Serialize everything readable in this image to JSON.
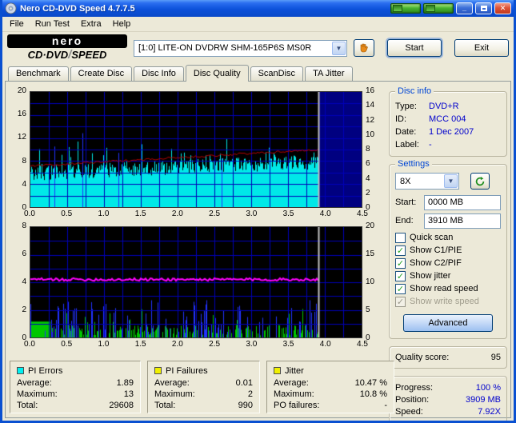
{
  "titlebar": {
    "title": "Nero CD-DVD Speed 4.7.7.5",
    "minimize": "_",
    "close": "✕"
  },
  "menu": [
    "File",
    "Run Test",
    "Extra",
    "Help"
  ],
  "logo": {
    "brand": "nero",
    "product_left": "CD·DVD",
    "sep": "/",
    "product_right": "SPEED"
  },
  "toolbar": {
    "drive": "[1:0]  LITE-ON DVDRW SHM-165P6S MS0R",
    "dropdown_arrow": "▼",
    "start": "Start",
    "exit": "Exit"
  },
  "tabs": [
    "Benchmark",
    "Create Disc",
    "Disc Info",
    "Disc Quality",
    "ScanDisc",
    "TA Jitter"
  ],
  "active_tab": "Disc Quality",
  "disc_info": {
    "title": "Disc info",
    "rows": [
      {
        "label": "Type:",
        "value": "DVD+R"
      },
      {
        "label": "ID:",
        "value": "MCC 004"
      },
      {
        "label": "Date:",
        "value": "1 Dec 2007"
      },
      {
        "label": "Label:",
        "value": "-"
      }
    ]
  },
  "settings": {
    "title": "Settings",
    "speed": "8X",
    "start_label": "Start:",
    "start_value": "0000 MB",
    "end_label": "End:",
    "end_value": "3910 MB",
    "checkboxes": [
      {
        "label": "Quick scan",
        "checked": false
      },
      {
        "label": "Show C1/PIE",
        "checked": true
      },
      {
        "label": "Show C2/PIF",
        "checked": true
      },
      {
        "label": "Show jitter",
        "checked": true
      },
      {
        "label": "Show read speed",
        "checked": true
      },
      {
        "label": "Show write speed",
        "checked": true,
        "disabled": true
      }
    ],
    "advanced": "Advanced"
  },
  "quality": {
    "label": "Quality score:",
    "value": "95"
  },
  "progress": {
    "rows": [
      {
        "label": "Progress:",
        "value": "100 %"
      },
      {
        "label": "Position:",
        "value": "3909 MB"
      },
      {
        "label": "Speed:",
        "value": "7.92X"
      }
    ]
  },
  "stats": [
    {
      "title": "PI Errors",
      "swatch": "#00f0f0",
      "rows": [
        {
          "label": "Average:",
          "value": "1.89"
        },
        {
          "label": "Maximum:",
          "value": "13"
        },
        {
          "label": "Total:",
          "value": "29608"
        }
      ]
    },
    {
      "title": "PI Failures",
      "swatch": "#f0f000",
      "rows": [
        {
          "label": "Average:",
          "value": "0.01"
        },
        {
          "label": "Maximum:",
          "value": "2"
        },
        {
          "label": "Total:",
          "value": "990"
        }
      ]
    },
    {
      "title": "Jitter",
      "swatch": "#f0f000",
      "rows": [
        {
          "label": "Average:",
          "value": "10.47 %"
        },
        {
          "label": "Maximum:",
          "value": "10.8 %"
        },
        {
          "label": "PO failures:",
          "value": "-"
        }
      ]
    }
  ],
  "charts": {
    "x_ticks": [
      "0.0",
      "0.5",
      "1.0",
      "1.5",
      "2.0",
      "2.5",
      "3.0",
      "3.5",
      "4.0",
      "4.5"
    ],
    "x_max": 4.5,
    "scan_end": 3.91,
    "top": {
      "left_ticks": [
        "20",
        "16",
        "12",
        "8",
        "4",
        "0"
      ],
      "right_ticks": [
        "16",
        "14",
        "12",
        "10",
        "8",
        "6",
        "4",
        "2",
        "0"
      ],
      "left_max": 20,
      "right_max": 16,
      "pie_base": 4.6,
      "pie_trend": 2.0,
      "speed_start": 5.7,
      "speed_end": 8.0,
      "colors": {
        "bg": "#000000",
        "unscanned": "#000080",
        "grid": "#0000b8",
        "pie": "#00e8e8",
        "spike": "#2233ff",
        "speed": "#b40000",
        "marker": "#c0c0c0"
      }
    },
    "bottom": {
      "left_ticks": [
        "8",
        "6",
        "4",
        "2",
        "0"
      ],
      "right_ticks": [
        "20",
        "15",
        "10",
        "5",
        "0"
      ],
      "left_max": 8,
      "right_max": 20,
      "jitter_avg": 10.5,
      "lead_block_end": 0.27,
      "lead_block_height": 1.15,
      "colors": {
        "bg": "#000000",
        "grid": "#0000b8",
        "pif": "#00c800",
        "spike": "#2233ff",
        "jitter": "#ff00ff",
        "marker": "#c0c0c0"
      }
    }
  }
}
